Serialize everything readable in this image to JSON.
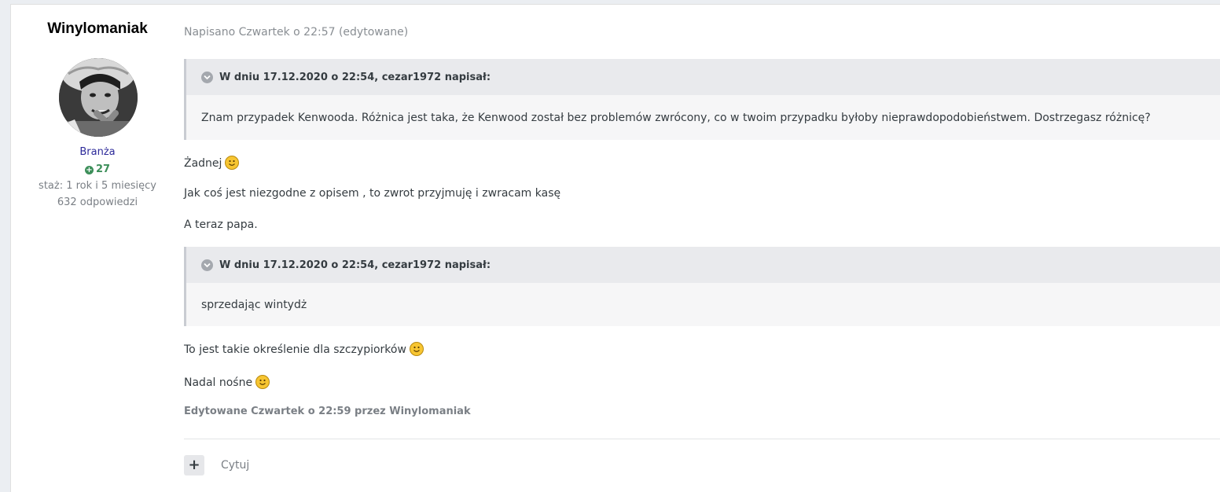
{
  "author": {
    "name": "Winylomaniak",
    "group": "Branża",
    "reputation": "27",
    "tenure": "staż: 1 rok i 5 miesięcy",
    "posts": "632 odpowiedzi"
  },
  "post": {
    "meta": "Napisano Czwartek o 22:57 (edytowane)",
    "quotes": [
      {
        "header": "W dniu 17.12.2020 o 22:54, cezar1972 napisał:",
        "body": "Znam przypadek Kenwooda. Różnica jest taka, że Kenwood został bez problemów zwrócony, co w twoim przypadku  byłoby nieprawdopodobieństwem. Dostrzegasz różnicę?"
      },
      {
        "header": "W dniu 17.12.2020 o 22:54, cezar1972 napisał:",
        "body": "sprzedając wintydż"
      }
    ],
    "paragraphs": [
      "Żadnej",
      "Jak coś jest niezgodne z opisem , to zwrot przyjmuję i zwracam kasę",
      "A teraz papa.",
      "To jest takie określenie dla szczypiorków",
      "Nadal nośne"
    ],
    "edited_note": "Edytowane Czwartek o 22:59 przez Winylomaniak",
    "quote_action": "Cytuj",
    "add_action": "+"
  },
  "icons": {
    "smile": "smile-emoji-icon",
    "chevron": "chevron-down-icon",
    "plus": "plus-circle-icon"
  },
  "colors": {
    "group": "#2d2a9a",
    "reputation": "#3d8f5a",
    "quote_header_bg": "#e9eaed",
    "quote_body_bg": "#f6f6f7"
  }
}
